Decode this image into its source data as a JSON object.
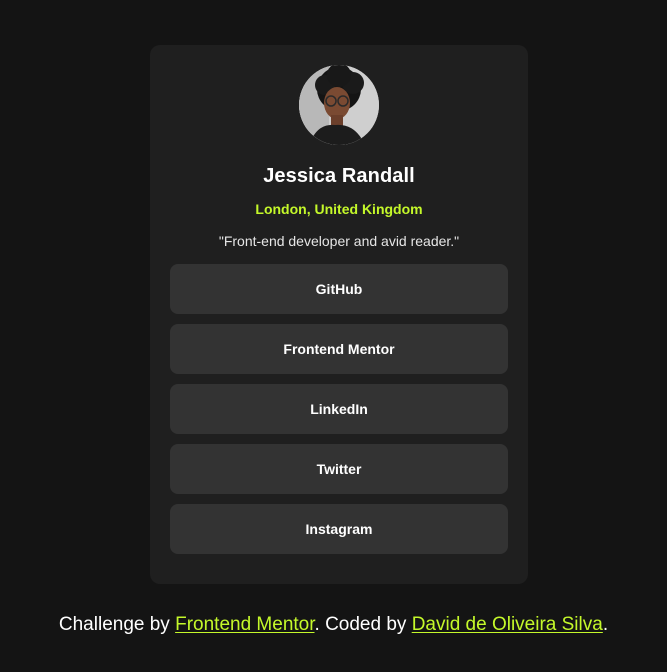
{
  "profile": {
    "name": "Jessica Randall",
    "location": "London, United Kingdom",
    "bio": "\"Front-end developer and avid reader.\""
  },
  "links": [
    {
      "label": "GitHub"
    },
    {
      "label": "Frontend Mentor"
    },
    {
      "label": "LinkedIn"
    },
    {
      "label": "Twitter"
    },
    {
      "label": "Instagram"
    }
  ],
  "footer": {
    "prefix": "Challenge by ",
    "link1": "Frontend Mentor",
    "middle": ". Coded by ",
    "link2": "David de Oliveira Silva",
    "suffix": "."
  },
  "colors": {
    "background": "#141414",
    "card": "#1f1f1f",
    "button": "#333333",
    "accent": "#c4f82a"
  }
}
